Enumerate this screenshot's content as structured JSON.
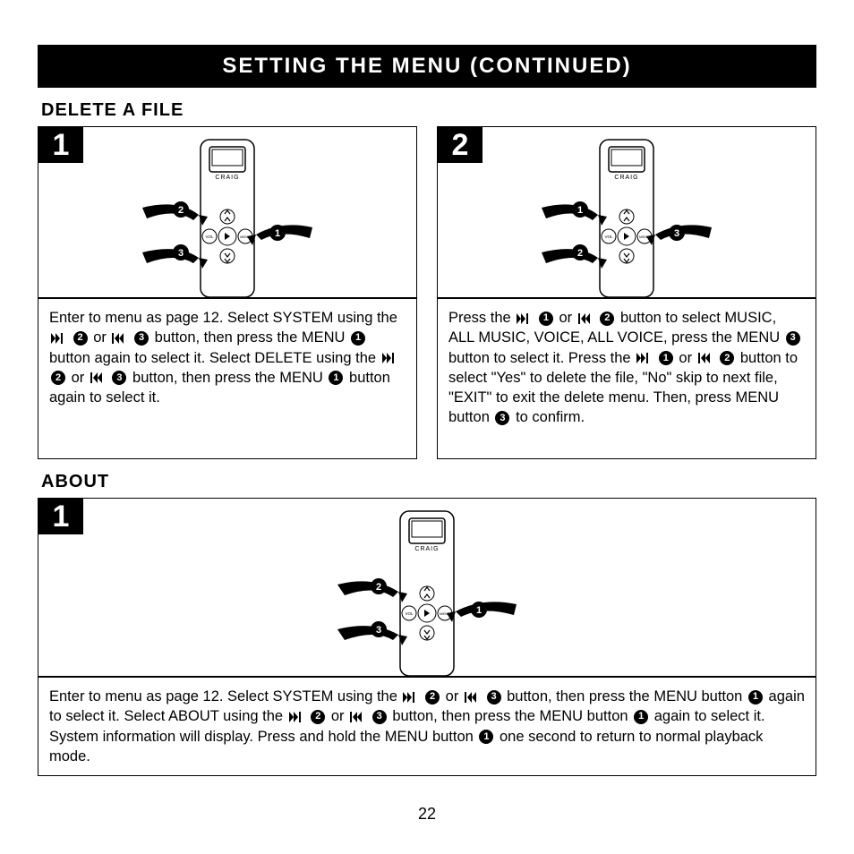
{
  "title": "SETTING THE MENU (CONTINUED)",
  "sections": {
    "delete": {
      "heading": "DELETE A FILE",
      "steps": {
        "1": {
          "badge": "1",
          "callouts": [
            "2",
            "3",
            "1"
          ],
          "text_parts": {
            "a": "Enter to menu as page 12. Select SYSTEM using the ",
            "b": " or ",
            "c": " button, then press the MENU ",
            "d": " button again to select it. Select DELETE using the ",
            "e": " or ",
            "f": " button, then press the MENU ",
            "g": " button again to select it."
          }
        },
        "2": {
          "badge": "2",
          "callouts": [
            "1",
            "2",
            "3"
          ],
          "text_parts": {
            "a": "Press the ",
            "b": " or ",
            "c": " button to select MUSIC, ALL MUSIC, VOICE, ALL VOICE, press the MENU ",
            "d": " button to select it. Press the ",
            "e": " or ",
            "f": " button to select \"Yes\" to delete the file, \"No\" skip to next file, \"EXIT\" to exit the delete menu. Then, press MENU button ",
            "g": " to confirm."
          }
        }
      }
    },
    "about": {
      "heading": "ABOUT",
      "step": {
        "badge": "1",
        "callouts": [
          "2",
          "3",
          "1"
        ],
        "text_parts": {
          "a": "Enter to menu as page 12. Select SYSTEM using the ",
          "b": " or ",
          "c": " button, then press the MENU button ",
          "d": " again to select it. Select ABOUT using the ",
          "e": " or ",
          "f": " button, then press the MENU button ",
          "g": " again to select it. System information will display. Press and hold the MENU button ",
          "h": " one second to return to normal playback mode."
        }
      }
    }
  },
  "page_number": "22",
  "device_brand": "CRAIG",
  "button_labels": {
    "vol": "VOL",
    "menu": "MENU"
  }
}
